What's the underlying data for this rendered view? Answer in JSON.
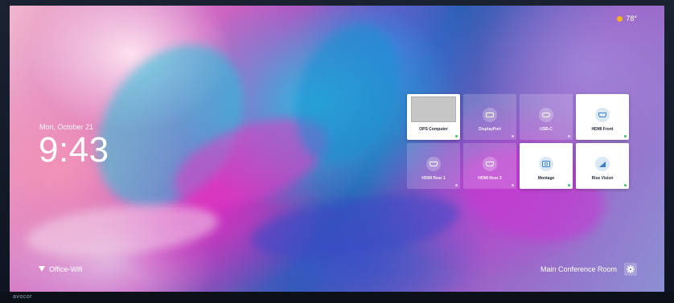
{
  "display": {
    "date": "Mon, October 21",
    "time": "9:43",
    "weather": {
      "temperature": "78°",
      "icon": "sun-icon",
      "icon_color": "#f5b21a"
    },
    "network": {
      "name": "Office-Wifi",
      "icon": "wifi-icon"
    },
    "room": {
      "name": "Main Conference Room",
      "settings_icon": "gear-icon"
    },
    "bezel_brand": "avocor"
  },
  "sources": [
    {
      "label": "OPS Computer",
      "icon": "computer-preview",
      "active": true
    },
    {
      "label": "DisplayPort",
      "icon": "displayport-icon",
      "active": false
    },
    {
      "label": "USB-C",
      "icon": "usbc-icon",
      "active": false
    },
    {
      "label": "HDMI Front",
      "icon": "hdmi-icon",
      "active": true
    },
    {
      "label": "HDMI Rear 1",
      "icon": "hdmi-icon",
      "active": false
    },
    {
      "label": "HDMI Rear 2",
      "icon": "hdmi-icon",
      "active": false
    },
    {
      "label": "Montage",
      "icon": "montage-icon",
      "active": true
    },
    {
      "label": "Rise Vision",
      "icon": "rise-vision-icon",
      "active": true
    }
  ],
  "colors": {
    "accent": "#3b7fc4",
    "status_green": "#39c26b"
  }
}
